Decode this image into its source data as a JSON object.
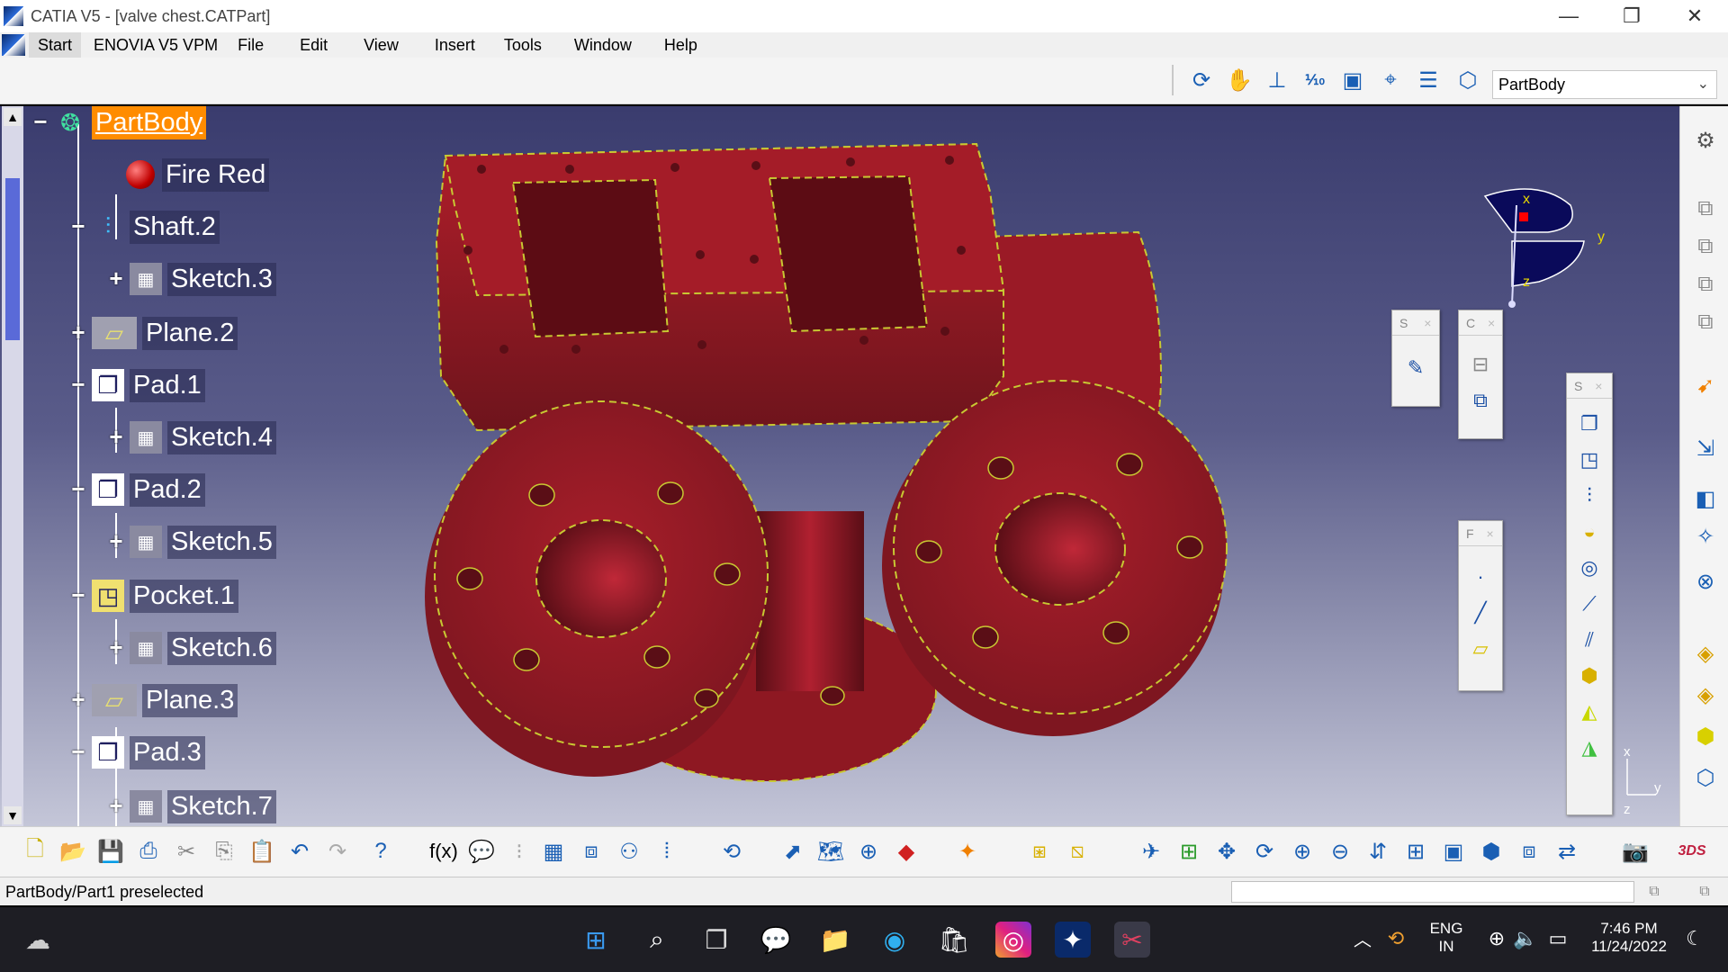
{
  "window": {
    "title": "CATIA V5 - [valve chest.CATPart]",
    "minimize": "—",
    "restore": "❐",
    "close": "✕"
  },
  "menu": {
    "items": [
      "Start",
      "ENOVIA V5 VPM",
      "File",
      "Edit",
      "View",
      "Insert",
      "Tools",
      "Window",
      "Help"
    ],
    "mdi_controls": [
      "_",
      "❐",
      "✕"
    ]
  },
  "toolbar": {
    "active_body": "PartBody",
    "view_icons": [
      "rotate-icon",
      "pan-hand-icon",
      "axis-icon",
      "measure-icon",
      "cube-view-icon",
      "compass-icon",
      "list-icon",
      "eraser-icon"
    ]
  },
  "tree": {
    "nodes": [
      {
        "label": "PartBody",
        "icon": "partbody-icon",
        "toggle": "−",
        "level": 0,
        "selected": true
      },
      {
        "label": "Fire Red",
        "icon": "material-ball-icon",
        "toggle": "",
        "level": 1
      },
      {
        "label": "Shaft.2",
        "icon": "shaft-icon",
        "toggle": "−",
        "level": 1
      },
      {
        "label": "Sketch.3",
        "icon": "sketch-icon",
        "toggle": "+",
        "level": 2
      },
      {
        "label": "Plane.2",
        "icon": "plane-icon",
        "toggle": "+",
        "level": 1
      },
      {
        "label": "Pad.1",
        "icon": "pad-icon",
        "toggle": "−",
        "level": 1
      },
      {
        "label": "Sketch.4",
        "icon": "sketch-icon",
        "toggle": "+",
        "level": 2
      },
      {
        "label": "Pad.2",
        "icon": "pad-icon",
        "toggle": "−",
        "level": 1
      },
      {
        "label": "Sketch.5",
        "icon": "sketch-icon",
        "toggle": "+",
        "level": 2
      },
      {
        "label": "Pocket.1",
        "icon": "pocket-icon",
        "toggle": "−",
        "level": 1
      },
      {
        "label": "Sketch.6",
        "icon": "sketch-icon",
        "toggle": "+",
        "level": 2
      },
      {
        "label": "Plane.3",
        "icon": "plane-icon",
        "toggle": "+",
        "level": 1
      },
      {
        "label": "Pad.3",
        "icon": "pad-icon",
        "toggle": "−",
        "level": 1
      },
      {
        "label": "Sketch.7",
        "icon": "sketch-icon",
        "toggle": "+",
        "level": 2
      }
    ]
  },
  "floating_toolbars": {
    "sketch_small": {
      "title": "S",
      "close": "×"
    },
    "constraint_small": {
      "title": "C",
      "close": "×"
    },
    "reference_small": {
      "title": "F",
      "close": "×"
    },
    "sketch_based": {
      "title": "S",
      "close": "×"
    }
  },
  "compass": {
    "x_label": "x",
    "y_label": "y",
    "z_label": "z"
  },
  "axis_indicator": {
    "x_label": "x",
    "y_label": "y",
    "z_label": "z"
  },
  "status": {
    "message": "PartBody/Part1 preselected"
  },
  "taskbar": {
    "language_line1": "ENG",
    "language_line2": "IN",
    "time": "7:46 PM",
    "date": "11/24/2022"
  },
  "colors": {
    "part_red": "#8b1a22",
    "edge_yellow": "#c8c832",
    "selection_orange": "#ff8c00",
    "accent_blue": "#1a5fb4"
  }
}
